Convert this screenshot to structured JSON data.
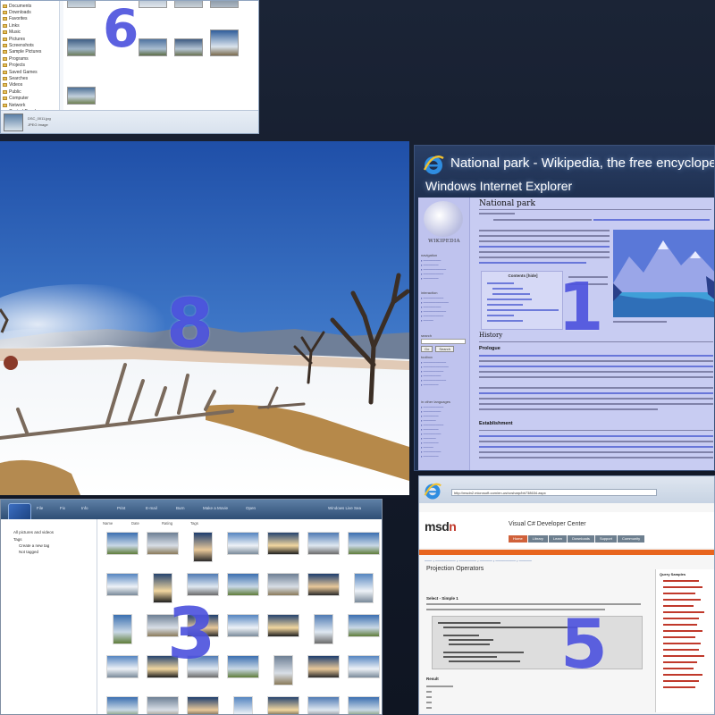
{
  "badges": {
    "w1": "1",
    "w3": "3",
    "w5": "5",
    "w6": "6",
    "w8": "8"
  },
  "ie_window": {
    "title_line1": "National park - Wikipedia, the free encyclopedia",
    "title_line2": "Windows Internet Explorer",
    "page_title": "National park",
    "logo_text": "WIKIPEDIA",
    "contents_header": "Contents [hide]",
    "section_history": "History",
    "section_prologue": "Prologue",
    "section_establishment": "Establishment",
    "search_button": "Go",
    "search_button2": "Search",
    "sidebar_headers": [
      "navigation",
      "interaction",
      "search",
      "toolbox",
      "in other languages"
    ]
  },
  "msdn_window": {
    "address": "http://msdn2.microsoft.com/en-us/vcsharp/bb738634.aspx",
    "logo_left": "msd",
    "logo_right": "n",
    "center_title": "Visual C# Developer Center",
    "tabs": [
      "Home",
      "Library",
      "Learn",
      "Downloads",
      "Support",
      "Community"
    ],
    "page_title": "Projection Operators",
    "right_header": "Query Samples",
    "sub_select": "Select - Simple 1",
    "sub_result": "Result"
  },
  "gallery_window": {
    "menu": [
      "File",
      "Fix",
      "Info",
      "Print",
      "E-mail",
      "Burn",
      "Make a Movie",
      "Open"
    ],
    "search_label": "Windows Live Sea",
    "tree": [
      "All pictures and videos",
      "Tags",
      "Create a new tag",
      "Not tagged"
    ],
    "columns": [
      "Name",
      "Date",
      "Rating",
      "Tags"
    ]
  },
  "explorer_window": {
    "nav": [
      "Documents",
      "Downloads",
      "Favorites",
      "Links",
      "Music",
      "Pictures",
      "Screenshots",
      "Sample Pictures",
      "Programs",
      "Projects",
      "Saved Games",
      "Searches",
      "Videos",
      "Public",
      "Computer",
      "Network",
      "Control Panel"
    ],
    "details_name": "DSC_0011.jpg",
    "details_type": "JPEG Image"
  },
  "colors": {
    "badge": "#4a4fdc",
    "ie_title_bg": "#1e2f4f",
    "msdn_accent": "#e8651e"
  }
}
